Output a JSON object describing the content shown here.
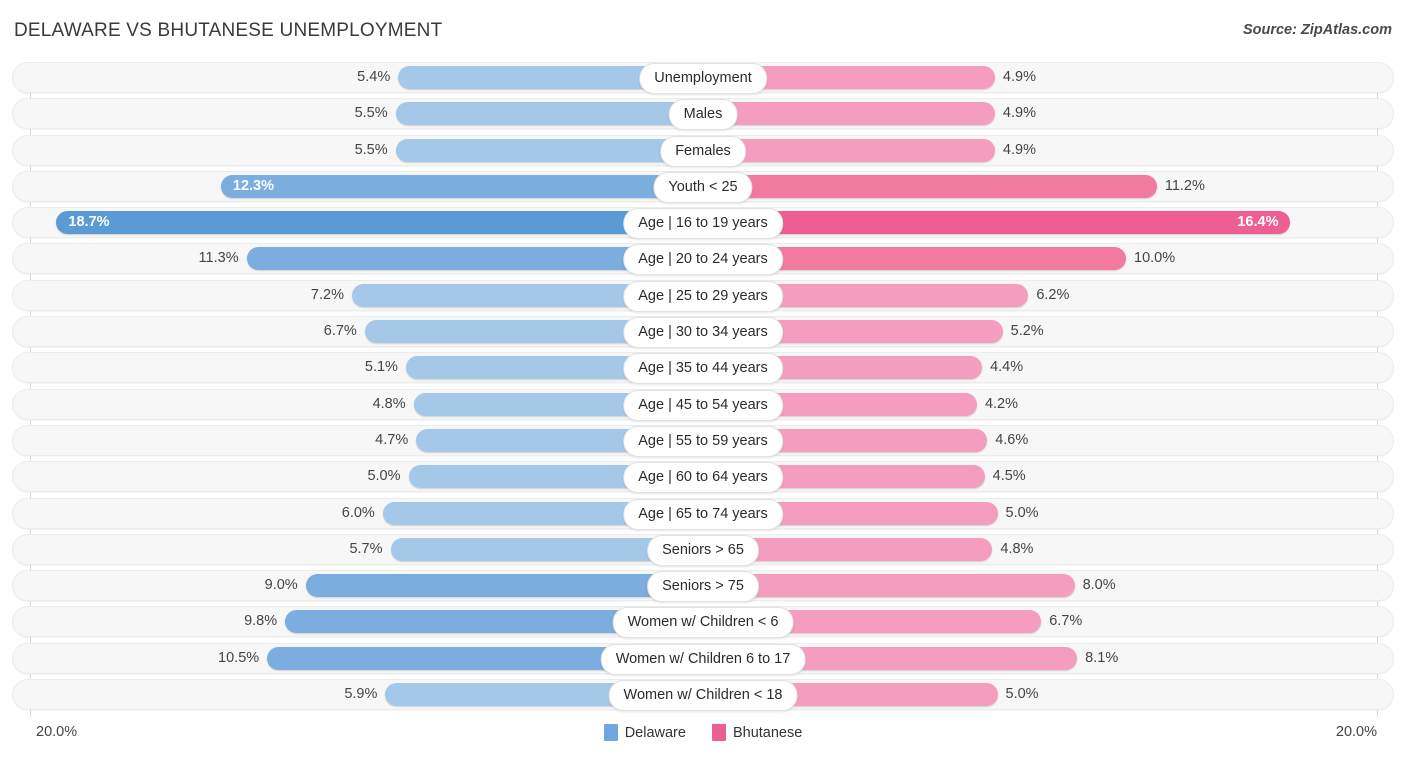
{
  "header": {
    "title": "DELAWARE VS BHUTANESE UNEMPLOYMENT",
    "source": "Source: ZipAtlas.com"
  },
  "footer": {
    "axis_left": "20.0%",
    "axis_right": "20.0%"
  },
  "legend": [
    {
      "label": "Delaware",
      "color": "#6fa8dc"
    },
    {
      "label": "Bhutanese",
      "color": "#ec5f93"
    }
  ],
  "colors": {
    "delaware_light": "#a5c8e8",
    "delaware_mid": "#7badde",
    "delaware_dark": "#5b9bd5",
    "bhutanese_light": "#f59dbe",
    "bhutanese_mid": "#f2799f",
    "bhutanese_dark": "#ee5e93",
    "track": "#f7f7f7",
    "gridline": "#d9d9d9"
  },
  "chart_data": {
    "type": "bar",
    "orientation": "horizontal-diverging",
    "title": "DELAWARE VS BHUTANESE UNEMPLOYMENT",
    "xlabel": "",
    "ylabel": "",
    "xlim": [
      20.0,
      20.0
    ],
    "axis_max": 20.0,
    "unit": "%",
    "grid": true,
    "legend_position": "bottom-center",
    "categories": [
      "Unemployment",
      "Males",
      "Females",
      "Youth < 25",
      "Age | 16 to 19 years",
      "Age | 20 to 24 years",
      "Age | 25 to 29 years",
      "Age | 30 to 34 years",
      "Age | 35 to 44 years",
      "Age | 45 to 54 years",
      "Age | 55 to 59 years",
      "Age | 60 to 64 years",
      "Age | 65 to 74 years",
      "Seniors > 65",
      "Seniors > 75",
      "Women w/ Children < 6",
      "Women w/ Children 6 to 17",
      "Women w/ Children < 18"
    ],
    "series": [
      {
        "name": "Delaware",
        "color": "#6fa8dc",
        "values": [
          5.4,
          5.5,
          5.5,
          12.3,
          18.7,
          11.3,
          7.2,
          6.7,
          5.1,
          4.8,
          4.7,
          5.0,
          6.0,
          5.7,
          9.0,
          9.8,
          10.5,
          5.9
        ],
        "labels": [
          "5.4%",
          "5.5%",
          "5.5%",
          "12.3%",
          "18.7%",
          "11.3%",
          "7.2%",
          "6.7%",
          "5.1%",
          "4.8%",
          "4.7%",
          "5.0%",
          "6.0%",
          "5.7%",
          "9.0%",
          "9.8%",
          "10.5%",
          "5.9%"
        ]
      },
      {
        "name": "Bhutanese",
        "color": "#ec5f93",
        "values": [
          4.9,
          4.9,
          4.9,
          11.2,
          16.4,
          10.0,
          6.2,
          5.2,
          4.4,
          4.2,
          4.6,
          4.5,
          5.0,
          4.8,
          8.0,
          6.7,
          8.1,
          5.0
        ],
        "labels": [
          "4.9%",
          "4.9%",
          "4.9%",
          "11.2%",
          "16.4%",
          "10.0%",
          "6.2%",
          "5.2%",
          "4.4%",
          "4.2%",
          "4.6%",
          "4.5%",
          "5.0%",
          "4.8%",
          "8.0%",
          "6.7%",
          "8.1%",
          "5.0%"
        ]
      }
    ]
  }
}
